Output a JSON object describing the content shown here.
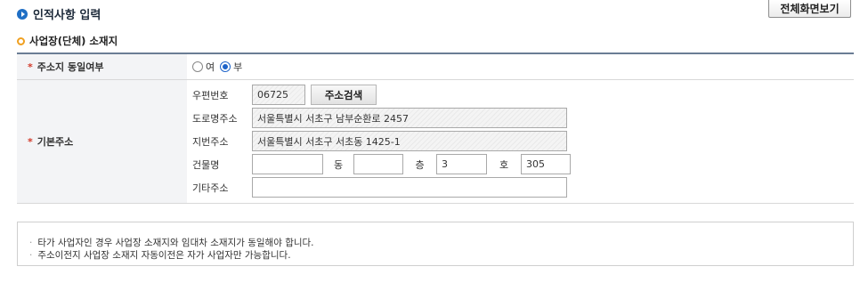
{
  "header": {
    "fullscreen_button": "전체화면보기",
    "section_title": "인적사항 입력",
    "sub_title": "사업장(단체) 소재지"
  },
  "form": {
    "same_address": {
      "label": "주소지 동일여부",
      "options": [
        "여",
        "부"
      ],
      "selected": "부"
    },
    "base_address": {
      "label": "기본주소",
      "postal_code_label": "우편번호",
      "postal_code": "06725",
      "search_button": "주소검색",
      "road_address_label": "도로명주소",
      "road_address": "서울특별시 서초구 남부순환로 2457",
      "lot_address_label": "지번주소",
      "lot_address": "서울특별시 서초구 서초동 1425-1",
      "building_label": "건물명",
      "building": "",
      "dong_label": "동",
      "dong": "",
      "floor_label": "층",
      "floor": "3",
      "ho_label": "호",
      "ho": "305",
      "etc_label": "기타주소",
      "etc": ""
    }
  },
  "notice": {
    "lines": [
      "타가 사업자인 경우 사업장 소재지와 임대차 소재지가 동일해야 합니다.",
      "주소이전지 사업장 소재지 자동이전은 자가 사업자만 가능합니다."
    ]
  },
  "colors": {
    "accent_blue": "#1f6fc5",
    "required_red": "#d23a2a",
    "bullet_orange": "#f0a020",
    "table_top_border": "#6a7d94"
  },
  "icons": {
    "section": "circle-arrow-icon",
    "sub_section": "orange-ring-icon"
  }
}
